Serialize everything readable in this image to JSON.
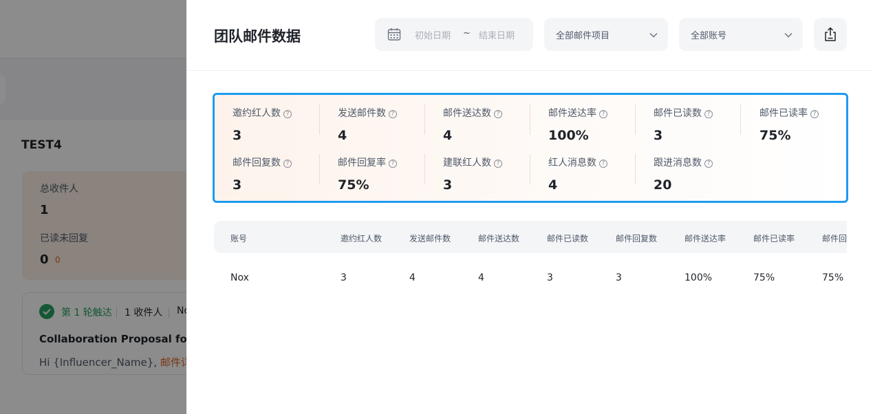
{
  "background": {
    "section_title": "TEST4",
    "total_recipients_label": "总收件人",
    "total_recipients_value": "1",
    "read_unreplied_label": "已读未回复",
    "read_unreplied_value": "0",
    "read_unreplied_sub": "0",
    "round_label": "第 1 轮触达",
    "recipients_label": "1 收件人",
    "truncated_text": "No",
    "subject": "Collaboration Proposal for {",
    "greeting": "Hi {Influencer_Name},",
    "greeting_link": "邮件详"
  },
  "drawer": {
    "title": "团队邮件数据",
    "date_start_placeholder": "初始日期",
    "date_separator": "~",
    "date_end_placeholder": "结束日期",
    "project_select": "全部邮件项目",
    "account_select": "全部账号"
  },
  "stats": [
    {
      "label": "邀约红人数",
      "value": "3"
    },
    {
      "label": "发送邮件数",
      "value": "4"
    },
    {
      "label": "邮件送达数",
      "value": "4"
    },
    {
      "label": "邮件送达率",
      "value": "100%"
    },
    {
      "label": "邮件已读数",
      "value": "3"
    },
    {
      "label": "邮件已读率",
      "value": "75%"
    },
    {
      "label": "邮件回复数",
      "value": "3"
    },
    {
      "label": "邮件回复率",
      "value": "75%"
    },
    {
      "label": "建联红人数",
      "value": "3"
    },
    {
      "label": "红人消息数",
      "value": "4"
    },
    {
      "label": "跟进消息数",
      "value": "20"
    }
  ],
  "table": {
    "headers": [
      "账号",
      "邀约红人数",
      "发送邮件数",
      "邮件送达数",
      "邮件已读数",
      "邮件回复数",
      "邮件送达率",
      "邮件已读率",
      "邮件回复率"
    ],
    "rows": [
      [
        "Nox",
        "3",
        "4",
        "4",
        "3",
        "3",
        "100%",
        "75%",
        "75%"
      ]
    ]
  },
  "icons": {
    "calendar": "calendar-icon",
    "chevron": "chevron-down-icon",
    "export": "export-icon",
    "help": "help-circle-icon",
    "check": "check-circle-icon"
  },
  "colors": {
    "accent_border": "#1d9bf0",
    "success": "#27a162",
    "warning_link": "#e0601f"
  }
}
